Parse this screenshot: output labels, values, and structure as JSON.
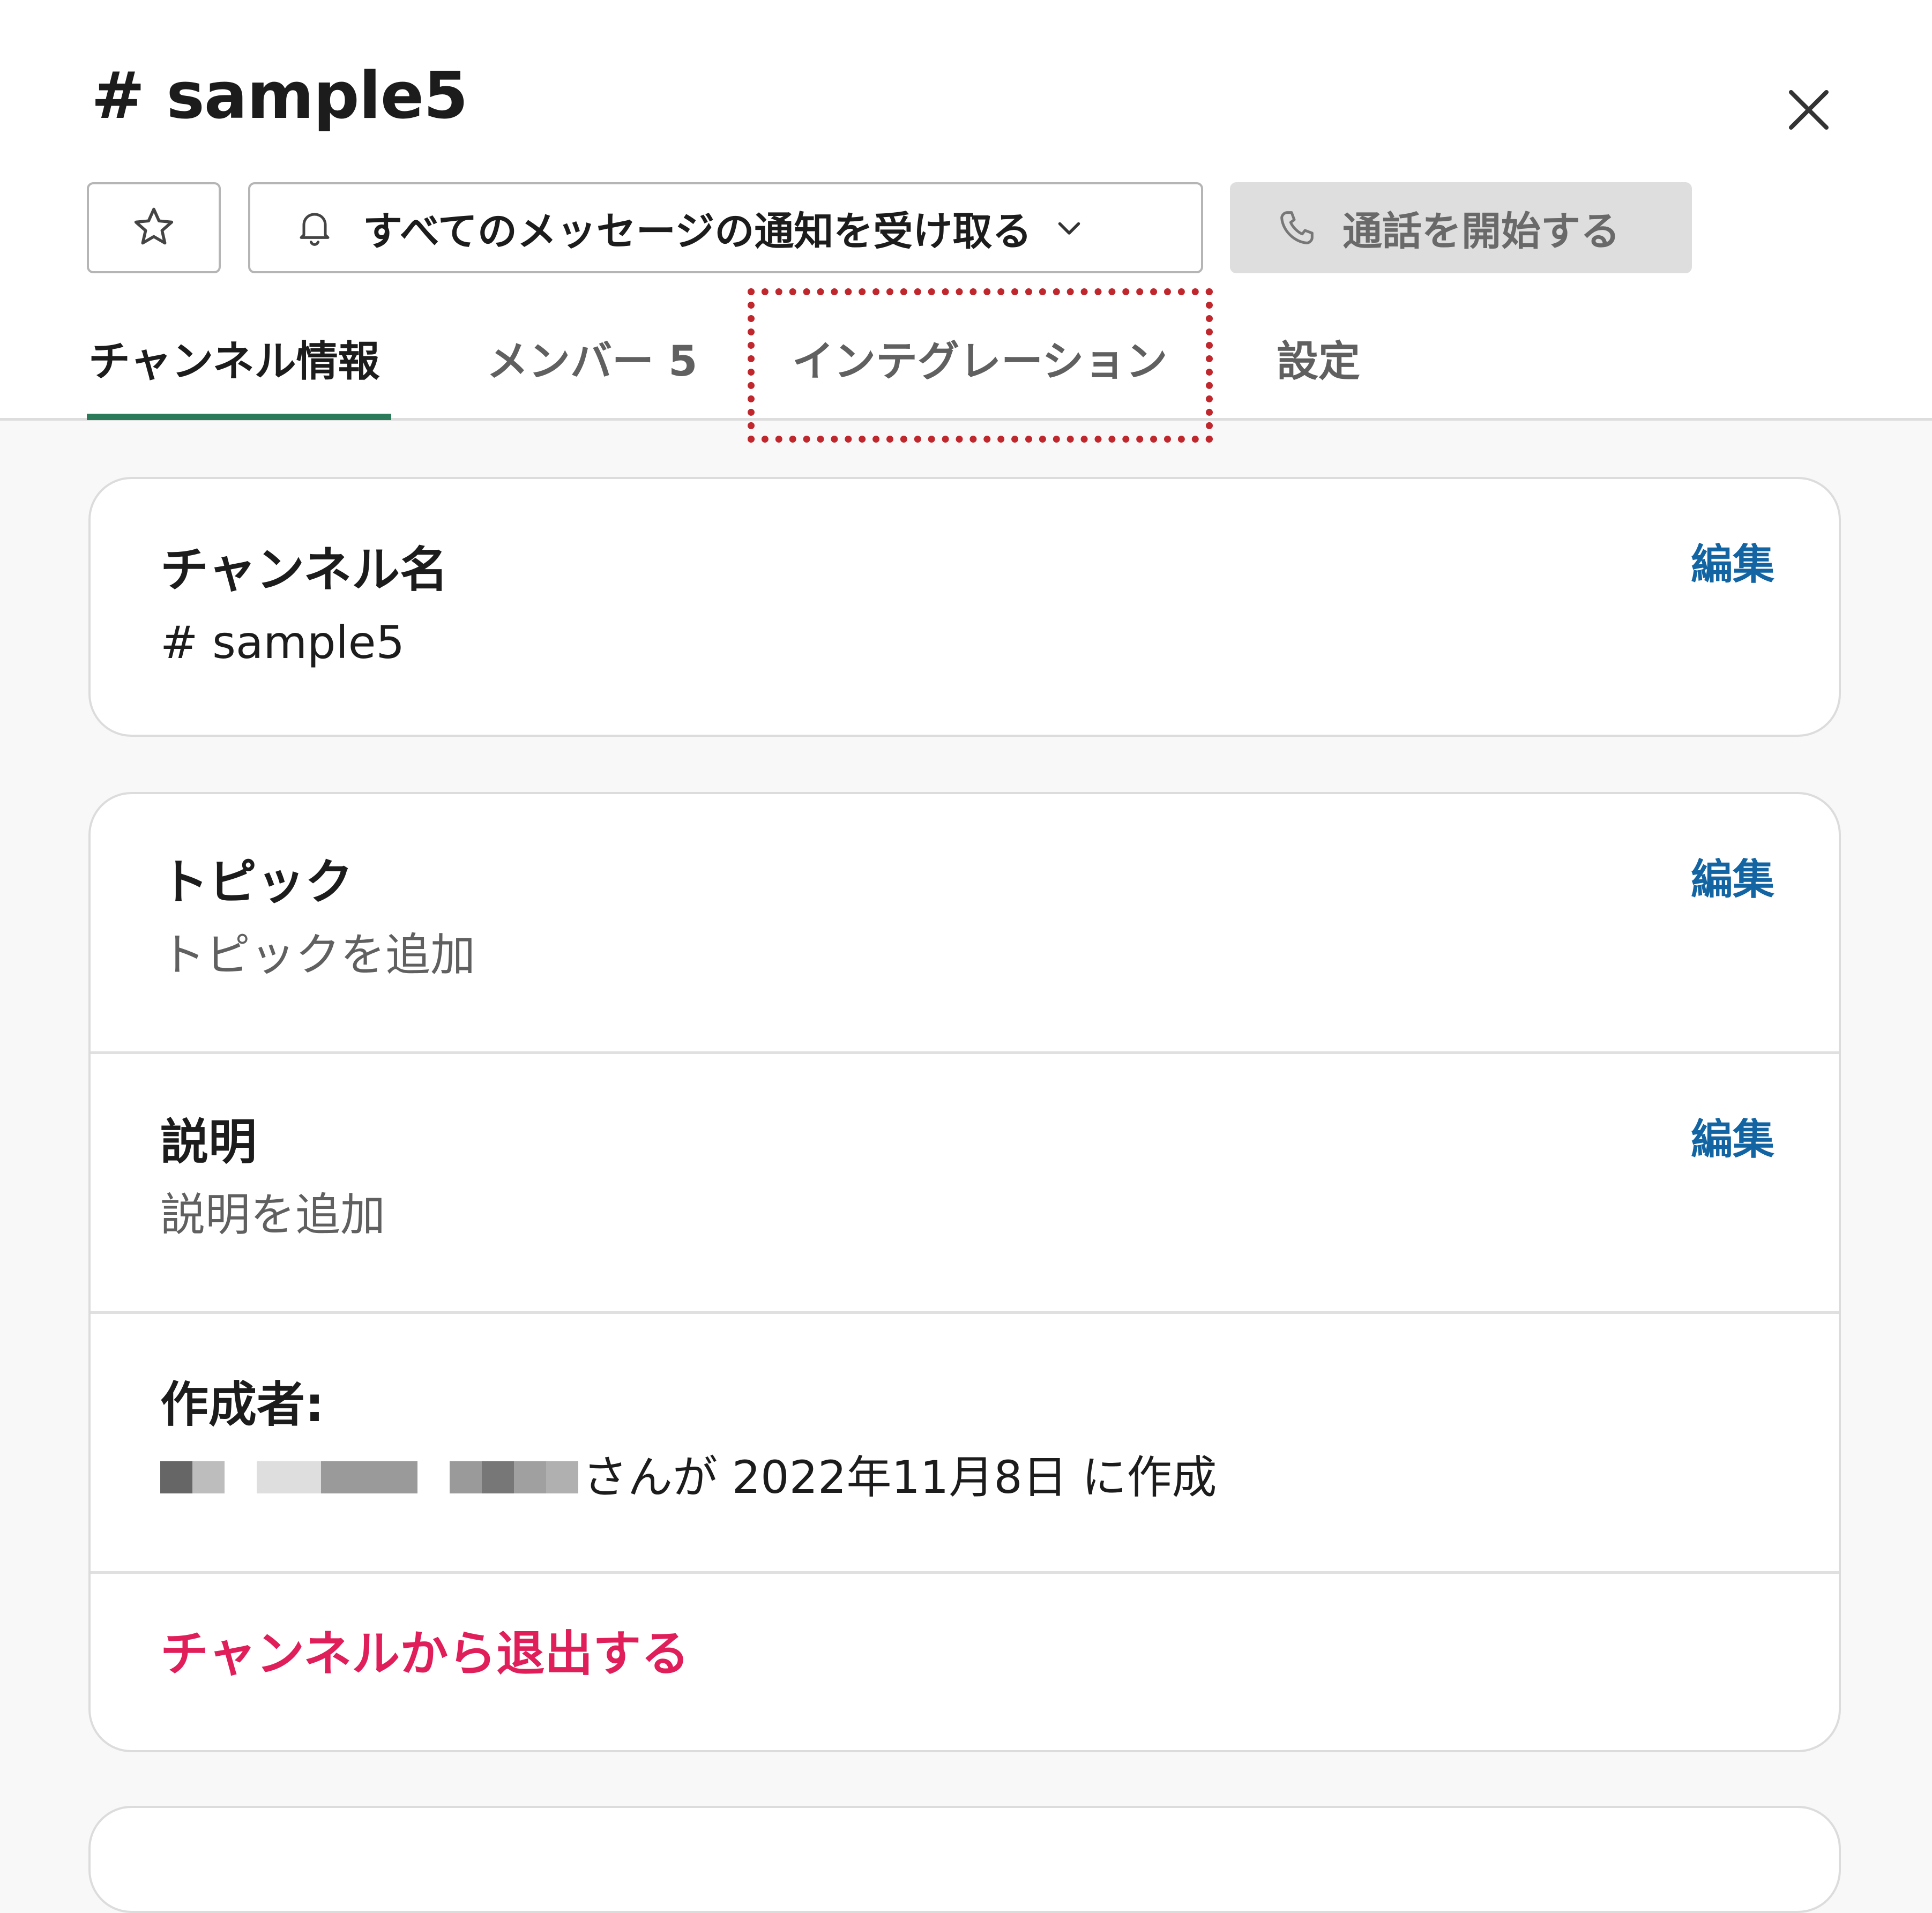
{
  "header": {
    "title": "# sample5",
    "close_icon": "close-icon"
  },
  "toolbar": {
    "star_icon": "star-icon",
    "notify_icon": "bell-icon",
    "notify_label": "すべてのメッセージの通知を受け取る",
    "notify_chevron": "chevron-down-icon",
    "call_icon": "phone-icon",
    "call_label": "通話を開始する"
  },
  "tabs": [
    {
      "label": "チャンネル情報",
      "active": true
    },
    {
      "label": "メンバー 5",
      "active": false
    },
    {
      "label": "インテグレーション",
      "active": false
    },
    {
      "label": "設定",
      "active": false
    }
  ],
  "annotation": {
    "highlight_color": "#c0272d",
    "style": "dotted"
  },
  "channel_name": {
    "label": "チャンネル名",
    "value": "# sample5",
    "edit": "編集"
  },
  "topic": {
    "label": "トピック",
    "value": "トピックを追加",
    "edit": "編集"
  },
  "description": {
    "label": "説明",
    "value": "説明を追加",
    "edit": "編集"
  },
  "creator": {
    "label": "作成者:",
    "value": "さんが 2022年11月8日 に作成"
  },
  "leave": {
    "label": "チャンネルから退出する"
  },
  "colors": {
    "accent_tab": "#2b7a5a",
    "link": "#1264a3",
    "danger": "#e01e5a"
  }
}
